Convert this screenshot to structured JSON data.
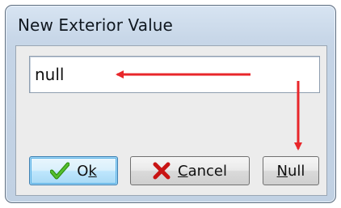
{
  "dialog": {
    "title": "New Exterior Value"
  },
  "input": {
    "value": "null"
  },
  "buttons": {
    "ok": {
      "pre": "O",
      "mnemonic": "k",
      "post": "",
      "icon": "checkmark-icon"
    },
    "cancel": {
      "pre": "",
      "mnemonic": "C",
      "post": "ancel",
      "icon": "cross-icon"
    },
    "null": {
      "pre": "",
      "mnemonic": "N",
      "post": "ull"
    }
  },
  "colors": {
    "annotation": "#e8262a",
    "check": "#3aa61c",
    "cross": "#c81414"
  }
}
